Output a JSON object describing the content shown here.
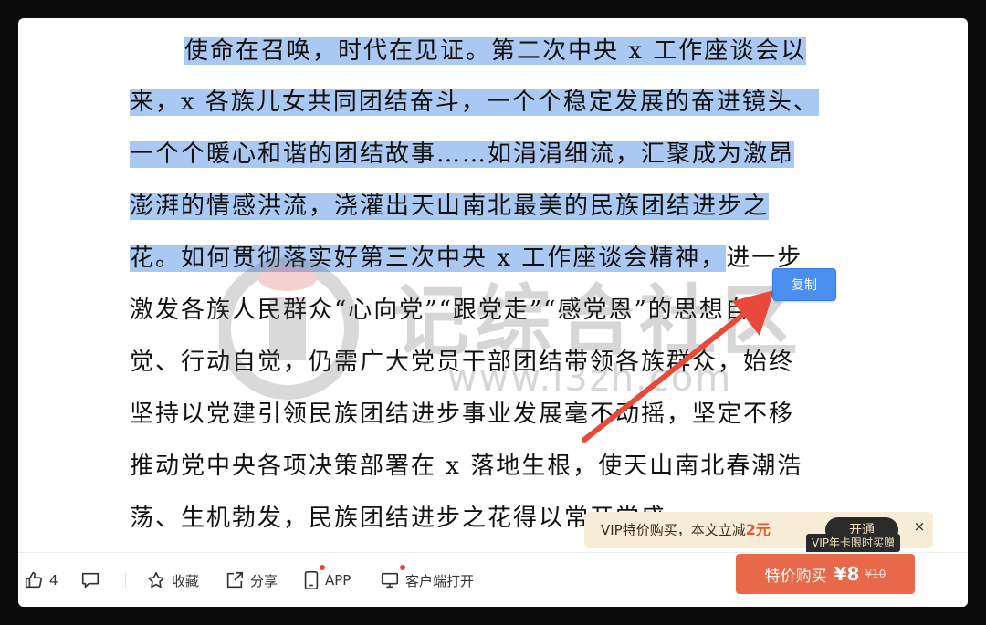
{
  "document": {
    "lines": [
      {
        "text": "使命在召唤，时代在见证。第二次中央 x 工作座谈会以",
        "selected": true
      },
      {
        "text": "来，x 各族儿女共同团结奋斗，一个个稳定发展的奋进镜头、",
        "selected": true
      },
      {
        "text": "一个个暖心和谐的团结故事……如涓涓细流，汇聚成为激昂",
        "selected": true
      },
      {
        "text": "澎湃的情感洪流，浇灌出天山南北最美的民族团结进步之",
        "selected": true
      },
      {
        "text_selected": "花。如何贯彻落实好第三次中央 x 工作座谈会精神，",
        "text_rest": "进一步"
      },
      {
        "text": "激发各族人民群众“心向党”“跟党走”“感党恩”的思想自"
      },
      {
        "text": "觉、行动自觉，仍需广大党员干部团结带领各族群众，始终"
      },
      {
        "text": "坚持以党建引领民族团结进步事业发展毫不动摇，坚定不移"
      },
      {
        "text": "推动党中央各项决策部署在 x 落地生根，使天山南北春潮浩"
      },
      {
        "text": "荡、生机勃发，民族团结进步之花得以常开常盛。"
      }
    ]
  },
  "watermark": {
    "text": "记综合社区",
    "url": "www.i3zh.com"
  },
  "copy_button": {
    "label": "复制"
  },
  "vip_banner": {
    "text": "VIP特价购买，本文立减",
    "amount": "2元",
    "open_label": "开通",
    "close_symbol": "×",
    "tag": "VIP年卡限时买赠"
  },
  "footer": {
    "like_count": "4",
    "collect_label": "收藏",
    "share_label": "分享",
    "app_label": "APP",
    "client_label": "客户端打开",
    "buy_label": "特价购买",
    "buy_price": "¥8",
    "buy_original": "¥10"
  },
  "colors": {
    "selection": "#a9c8f2",
    "copy_button": "#4a8ff0",
    "buy_button": "#e8694a",
    "vip_banner": "#f7edd6",
    "arrow": "#e8493a"
  }
}
